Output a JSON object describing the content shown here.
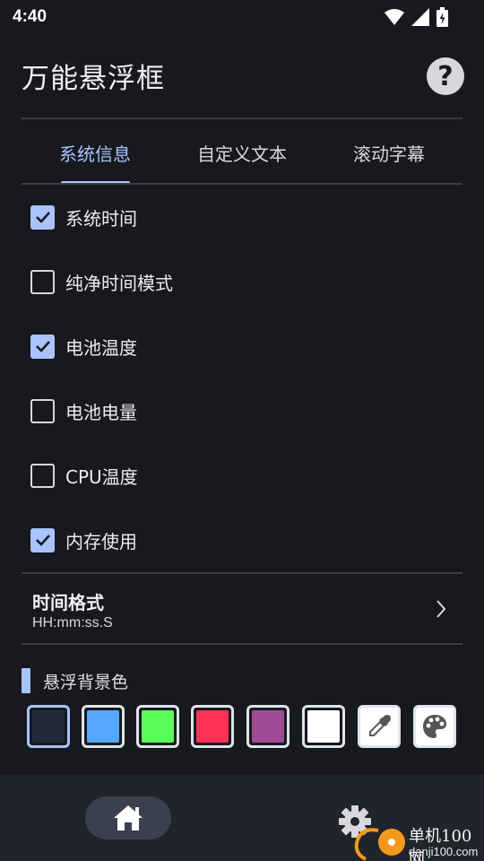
{
  "status_bar": {
    "time": "4:40",
    "icons": [
      "wifi-icon",
      "signal-icon",
      "battery-charging-icon"
    ]
  },
  "app": {
    "title": "万能悬浮框",
    "help_icon": "help-circle-icon",
    "help_glyph": "?"
  },
  "tabs": [
    {
      "label": "系统信息",
      "active": true
    },
    {
      "label": "自定义文本",
      "active": false
    },
    {
      "label": "滚动字幕",
      "active": false
    }
  ],
  "options": [
    {
      "label": "系统时间",
      "checked": true
    },
    {
      "label": "纯净时间模式",
      "checked": false
    },
    {
      "label": "电池温度",
      "checked": true
    },
    {
      "label": "电池电量",
      "checked": false
    },
    {
      "label": "CPU温度",
      "checked": false
    },
    {
      "label": "内存使用",
      "checked": true
    }
  ],
  "time_format": {
    "title": "时间格式",
    "value": "HH:mm:ss.S",
    "icon": "chevron-right-icon"
  },
  "background_color": {
    "title": "悬浮背景色",
    "swatches": [
      {
        "name": "dark-navy",
        "color": "#222a3a",
        "selected": true
      },
      {
        "name": "blue",
        "color": "#56a7ff",
        "selected": false
      },
      {
        "name": "green",
        "color": "#5afe58",
        "selected": false
      },
      {
        "name": "red",
        "color": "#ff3157",
        "selected": false
      },
      {
        "name": "purple",
        "color": "#a04a97",
        "selected": false
      },
      {
        "name": "white",
        "color": "#ffffff",
        "selected": false
      }
    ],
    "tools": [
      "eyedropper-icon",
      "palette-icon"
    ]
  },
  "bottom_nav": {
    "items": [
      "home-icon",
      "gear-icon"
    ]
  },
  "watermark": {
    "name": "单机100网",
    "url": "danji100.com"
  },
  "colors": {
    "background": "#17191e",
    "accent": "#a9c3ff",
    "nav": "#21242b"
  }
}
